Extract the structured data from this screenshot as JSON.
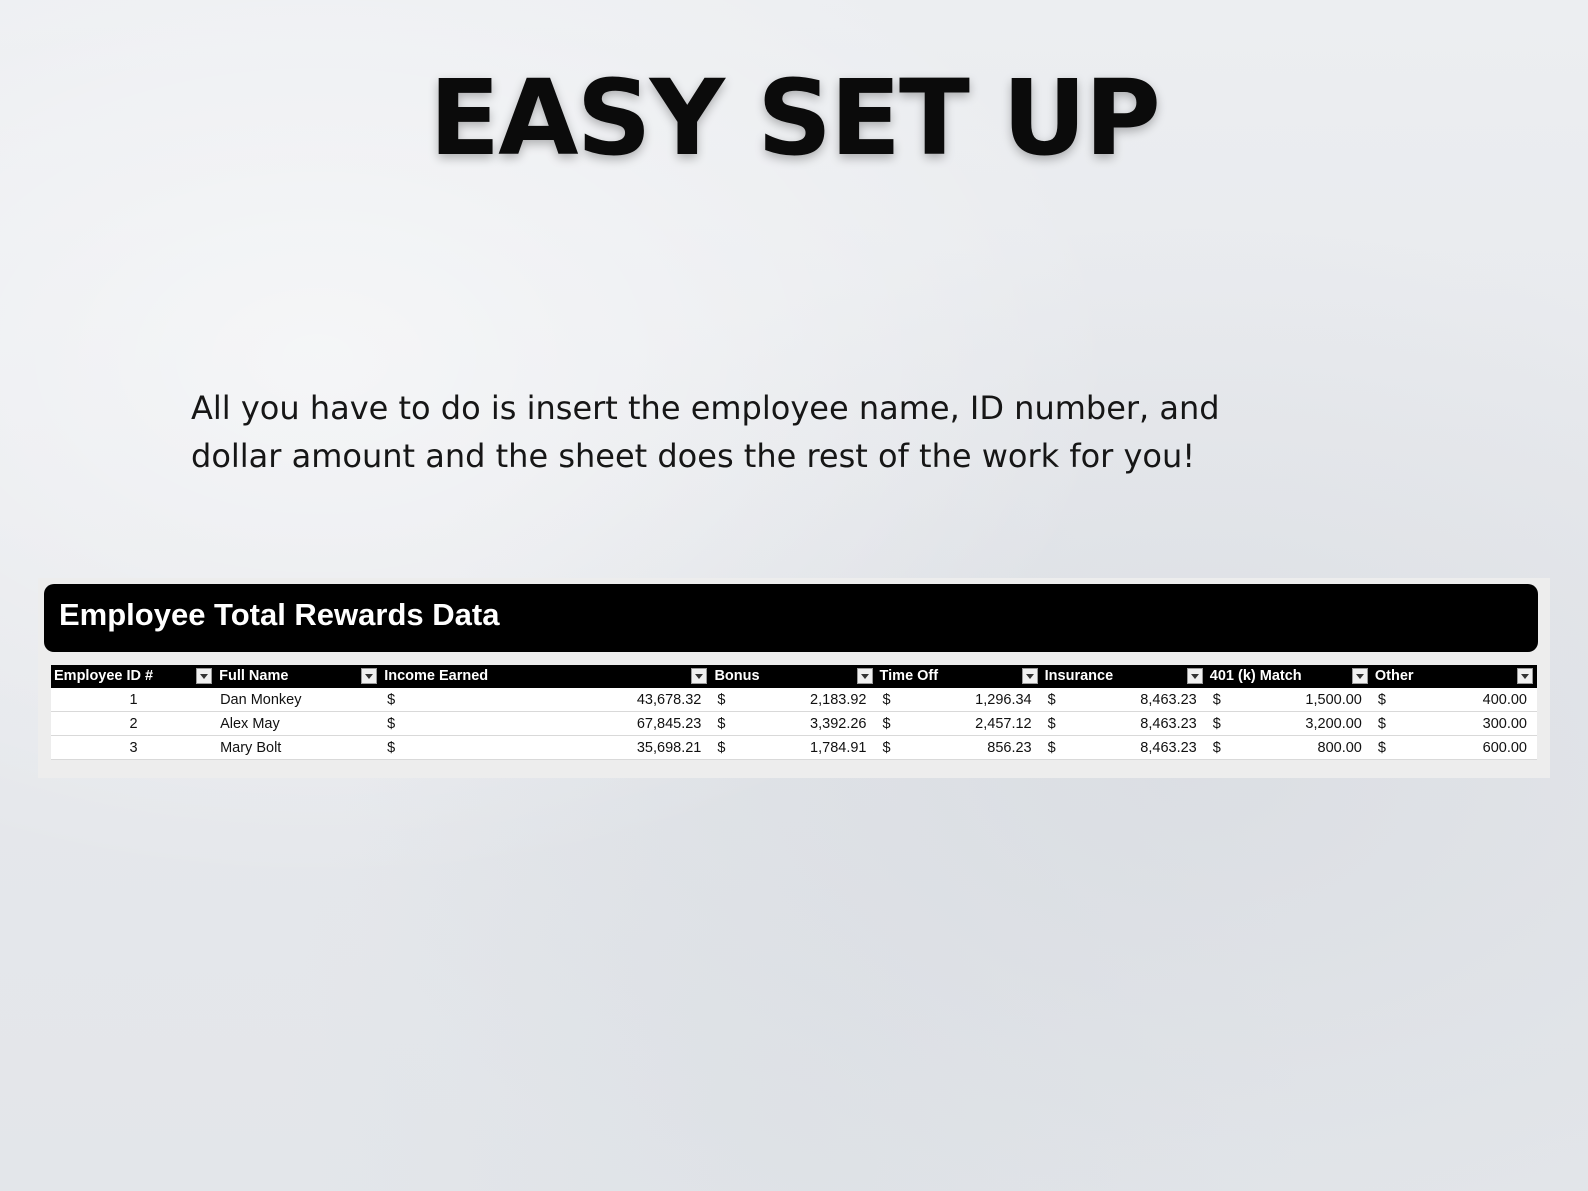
{
  "headline": "EASY SET UP",
  "description": "All you have to do is insert the employee name, ID number, and dollar amount and the sheet does the rest of the work for you!",
  "sheet": {
    "title": "Employee Total Rewards Data",
    "columns": [
      "Employee ID #",
      "Full Name",
      "Income Earned",
      "Bonus",
      "Time Off",
      "Insurance",
      "401 (k) Match",
      "Other"
    ],
    "currency_symbol": "$",
    "rows": [
      {
        "id": "1",
        "name": "Dan Monkey",
        "income": "43,678.32",
        "bonus": "2,183.92",
        "time_off": "1,296.34",
        "insurance": "8,463.23",
        "match": "1,500.00",
        "other": "400.00"
      },
      {
        "id": "2",
        "name": "Alex May",
        "income": "67,845.23",
        "bonus": "3,392.26",
        "time_off": "2,457.12",
        "insurance": "8,463.23",
        "match": "3,200.00",
        "other": "300.00"
      },
      {
        "id": "3",
        "name": "Mary Bolt",
        "income": "35,698.21",
        "bonus": "1,784.91",
        "time_off": "856.23",
        "insurance": "8,463.23",
        "match": "800.00",
        "other": "600.00"
      }
    ]
  },
  "colors": {
    "background": "#e9ebee",
    "header": "#000000",
    "text": "#111111"
  }
}
